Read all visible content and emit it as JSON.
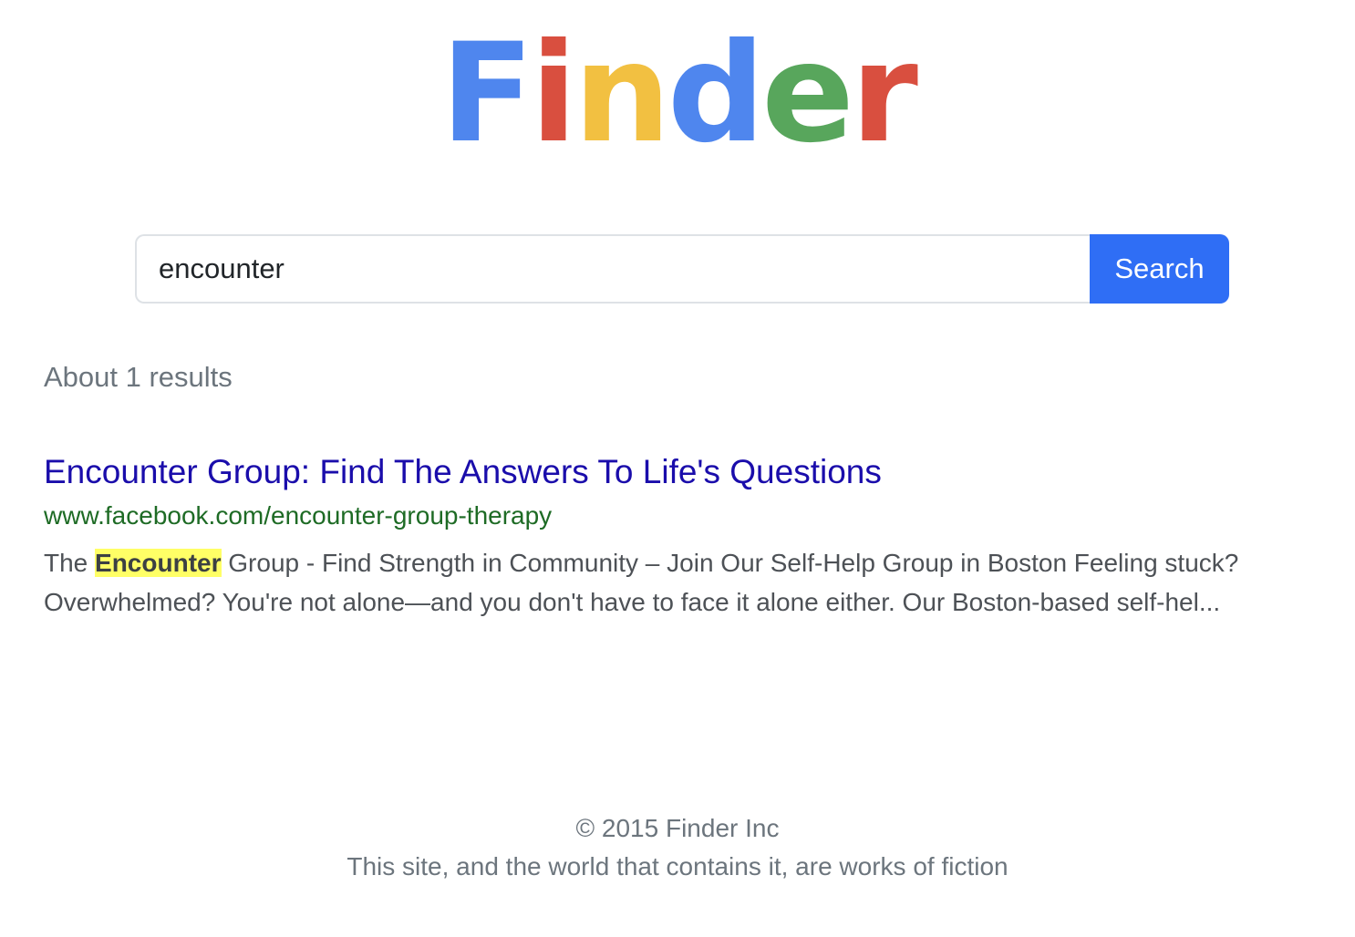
{
  "logo": {
    "letters": [
      {
        "char": "F",
        "color": "#4f86ee"
      },
      {
        "char": "i",
        "color": "#d94f3f"
      },
      {
        "char": "n",
        "color": "#f2c041"
      },
      {
        "char": "d",
        "color": "#4f86ee"
      },
      {
        "char": "e",
        "color": "#58a65c"
      },
      {
        "char": "r",
        "color": "#d94f3f"
      }
    ]
  },
  "search": {
    "value": "encounter",
    "button_label": "Search"
  },
  "results_summary": "About 1 results",
  "results": [
    {
      "title": "Encounter Group: Find The Answers To Life's Questions",
      "url": "www.facebook.com/encounter-group-therapy",
      "snippet_before": "The ",
      "snippet_highlight": "Encounter",
      "snippet_after": " Group - Find Strength in Community – Join Our Self-Help Group in Boston Feeling stuck? Overwhelmed? You're not alone—and you don't have to face it alone either. Our Boston-based self-hel..."
    }
  ],
  "footer": {
    "copyright": "© 2015 Finder Inc",
    "disclaimer": "This site, and the world that contains it, are works of fiction"
  },
  "colors": {
    "search_button": "#2f6ef5",
    "result_title": "#1a0dab",
    "result_url": "#1e6b25",
    "highlight": "#ffff66"
  }
}
